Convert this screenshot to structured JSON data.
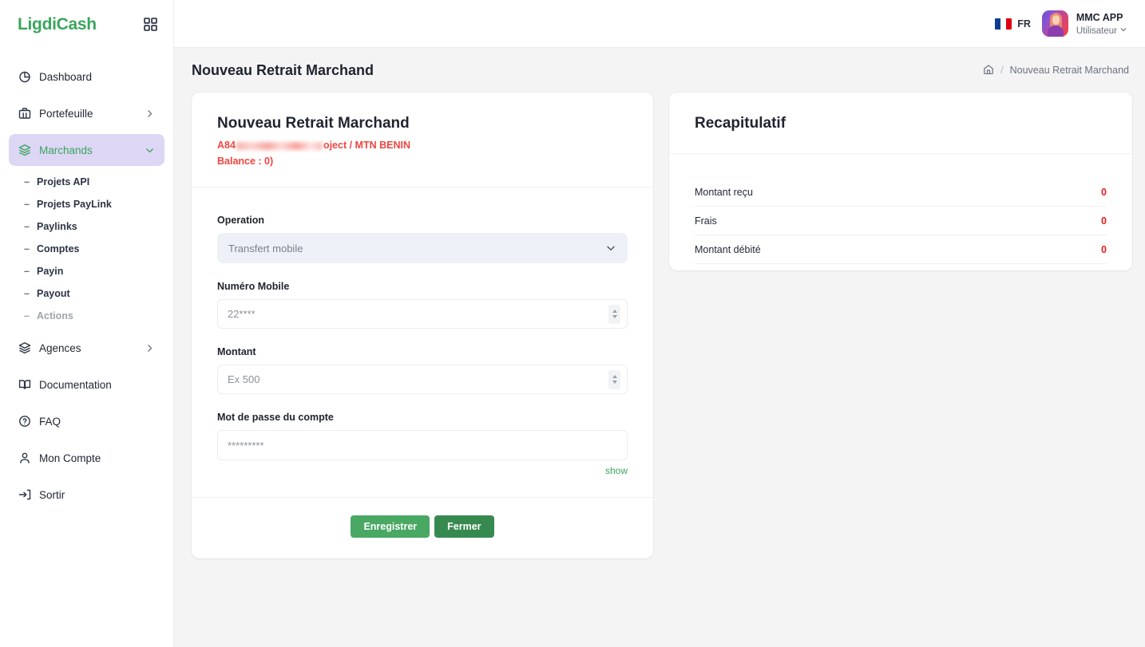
{
  "brand": {
    "name": "LigdiCash",
    "grid_icon": "grid-icon",
    "accent": "#3ba55d"
  },
  "sidebar": {
    "items": [
      {
        "label": "Dashboard",
        "icon": "pie-chart-icon",
        "type": "item"
      },
      {
        "label": "Portefeuille",
        "icon": "briefcase-icon",
        "type": "item",
        "chevron": "chevron-right-icon"
      },
      {
        "label": "Marchands",
        "icon": "layers-icon",
        "type": "item",
        "active": true,
        "chevron": "chevron-down-icon"
      }
    ],
    "sub_items": [
      {
        "label": "Projets API",
        "muted": false
      },
      {
        "label": "Projets PayLink",
        "muted": false
      },
      {
        "label": "Paylinks",
        "muted": false
      },
      {
        "label": "Comptes",
        "muted": false
      },
      {
        "label": "Payin",
        "muted": false
      },
      {
        "label": "Payout",
        "muted": false
      },
      {
        "label": "Actions",
        "muted": true
      }
    ],
    "items_bottom": [
      {
        "label": "Agences",
        "icon": "layers-icon",
        "chevron": "chevron-right-icon"
      },
      {
        "label": "Documentation",
        "icon": "book-icon"
      },
      {
        "label": "FAQ",
        "icon": "help-circle-icon"
      },
      {
        "label": "Mon Compte",
        "icon": "user-icon"
      },
      {
        "label": "Sortir",
        "icon": "logout-icon"
      }
    ]
  },
  "topbar": {
    "language": "FR",
    "flag": "france-flag-icon",
    "user_name": "MMC APP",
    "user_role": "Utilisateur",
    "user_chevron": "chevron-down-icon",
    "avatar": "user-avatar"
  },
  "page": {
    "title": "Nouveau Retrait Marchand",
    "breadcrumb_home_icon": "home-icon",
    "breadcrumb_sep": "/",
    "breadcrumb_current": "Nouveau Retrait Marchand"
  },
  "form_card": {
    "title": "Nouveau Retrait Marchand",
    "subtitle_prefix": "A84",
    "subtitle_suffix": "oject / MTN BENIN",
    "balance_line": "Balance : 0)",
    "fields": {
      "operation": {
        "label": "Operation",
        "value": "Transfert mobile",
        "chevron": "chevron-down-icon"
      },
      "mobile": {
        "label": "Numéro Mobile",
        "placeholder": "22****",
        "spinner": "number-spinner-icon"
      },
      "montant": {
        "label": "Montant",
        "placeholder": "Ex 500",
        "spinner": "number-spinner-icon"
      },
      "password": {
        "label": "Mot de passe du compte",
        "placeholder": "*********",
        "show_label": "show"
      }
    },
    "buttons": {
      "save": "Enregistrer",
      "close": "Fermer"
    }
  },
  "recap_card": {
    "title": "Recapitulatif",
    "rows": [
      {
        "label": "Montant reçu",
        "value": "0",
        "bold": false
      },
      {
        "label": "Frais",
        "value": "0",
        "bold": false
      },
      {
        "label": "Montant débité",
        "value": "0",
        "bold": true
      }
    ]
  }
}
